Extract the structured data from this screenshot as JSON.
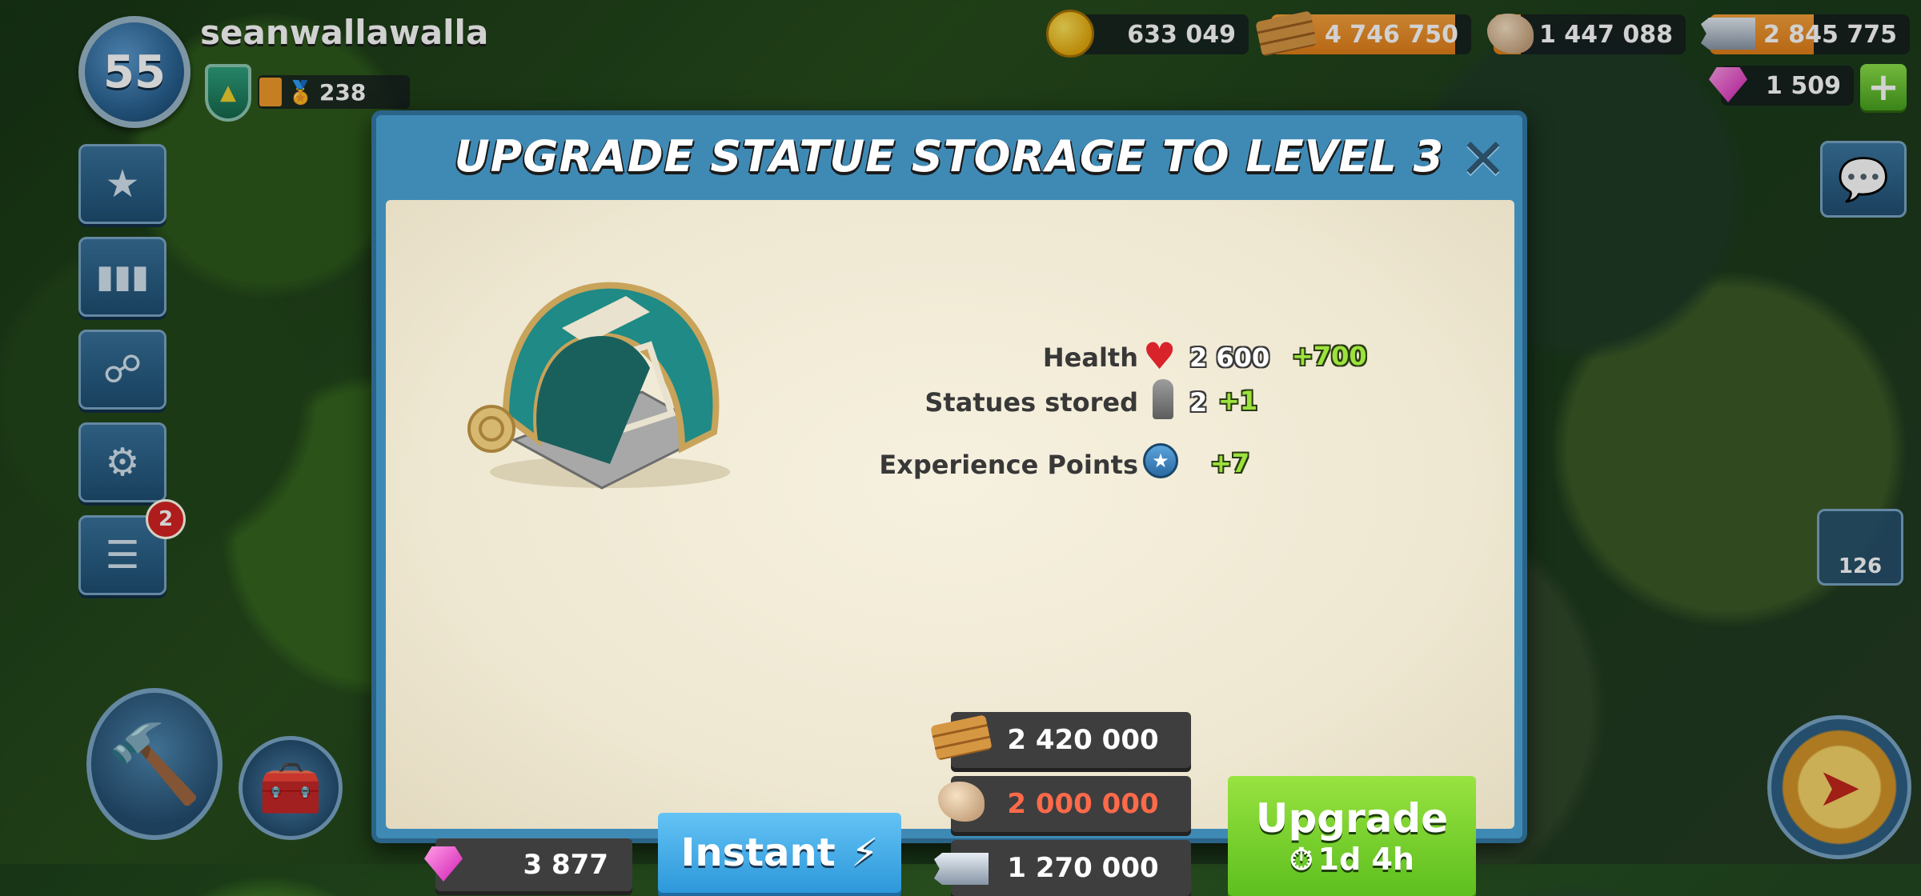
{
  "player": {
    "level": "55",
    "name": "seanwallawalla",
    "rank_points": "238"
  },
  "resources": {
    "gold": "633 049",
    "wood": "4 746 750",
    "stone": "1 447 088",
    "iron": "2 845 775",
    "diamonds": "1 509"
  },
  "left_menu": {
    "items": [
      {
        "icon": "stars-icon"
      },
      {
        "icon": "leaderboard-icon"
      },
      {
        "icon": "task-force-icon"
      },
      {
        "icon": "gear-icon"
      },
      {
        "icon": "news-icon",
        "badge": "2"
      }
    ]
  },
  "right_side": {
    "troops_count": "126"
  },
  "dialog": {
    "title": "UPGRADE STATUE STORAGE TO LEVEL 3",
    "stats": {
      "health": {
        "label": "Health",
        "value": "2 600",
        "increase": "+700"
      },
      "statues": {
        "label": "Statues stored",
        "value": "2",
        "increase": "+1"
      },
      "xp": {
        "label": "Experience Points",
        "increase": "+7"
      }
    },
    "costs": {
      "wood": "2 420 000",
      "stone": "2 000 000",
      "iron": "1 270 000"
    },
    "instant": {
      "diamond_cost": "3 877",
      "label": "Instant"
    },
    "upgrade": {
      "label": "Upgrade",
      "time": "1d 4h"
    }
  },
  "colors": {
    "dialog_blue": "#3f8ab5",
    "parchment": "#f3eedb",
    "upgrade_green": "#7dd134",
    "instant_blue": "#45adea",
    "insufficient_red": "#ff6a4a",
    "bonus_green": "#9be23c"
  }
}
